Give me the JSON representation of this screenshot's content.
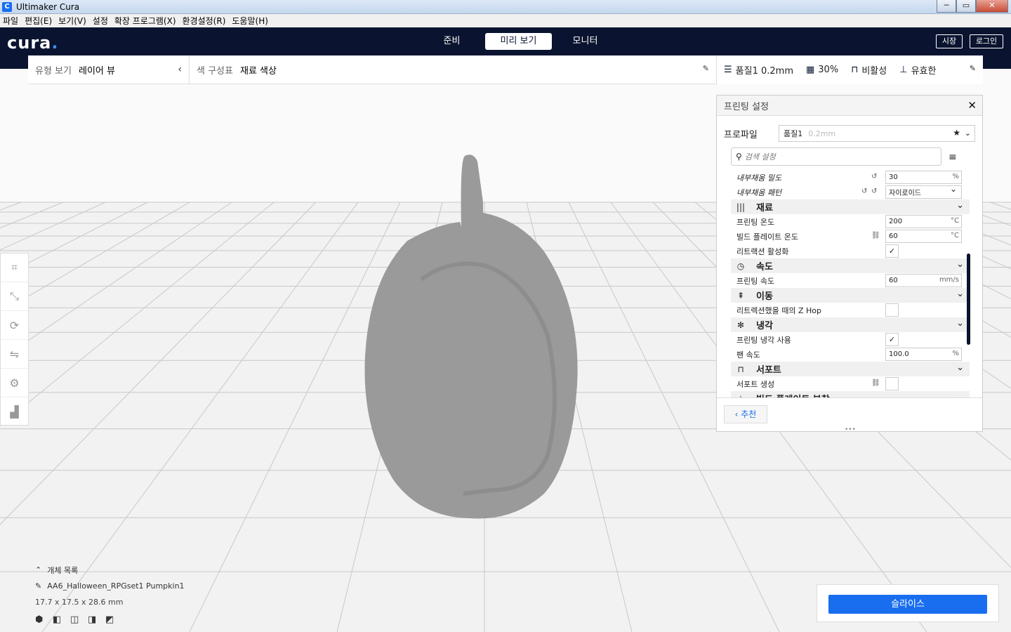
{
  "window": {
    "title": "Ultimaker Cura",
    "app_icon": "C",
    "minimize": "─",
    "maximize": "▭",
    "close": "✕"
  },
  "menubar": [
    "파일",
    "편집(E)",
    "보기(V)",
    "설정",
    "확장 프로그램(X)",
    "환경설정(R)",
    "도움말(H)"
  ],
  "header": {
    "logo": "cura",
    "tabs": [
      "준비",
      "미리 보기",
      "모니터"
    ],
    "active_tab": "미리 보기",
    "marketplace": "시장",
    "login": "로그인"
  },
  "viewpanel": {
    "view_type_label": "유형 보기",
    "view_type_value": "레이어 뷰",
    "color_scheme_label": "색 구성표",
    "color_scheme_value": "재료 색상"
  },
  "setupbar": {
    "profile": "품질1 0.2mm",
    "infill": "30%",
    "support": "비활성",
    "adhesion": "유효한"
  },
  "settings": {
    "title": "프린팅 설정",
    "profile_label": "프로파일",
    "profile_name": "품질1",
    "profile_sub": "0.2mm",
    "search_placeholder": "검색 설정",
    "rows": [
      {
        "kind": "row",
        "name": "내부채움 밀도",
        "value": "30",
        "unit": "%"
      },
      {
        "kind": "row",
        "name": "내부채움 패턴",
        "value": "자이로이드"
      },
      {
        "kind": "cat",
        "name": "재료"
      },
      {
        "kind": "row",
        "name": "프린팅 온도",
        "value": "200",
        "unit": "°C"
      },
      {
        "kind": "row",
        "name": "빌드 플레이트 온도",
        "value": "60",
        "unit": "°C"
      },
      {
        "kind": "row",
        "name": "리트랙션 활성화",
        "checked": true
      },
      {
        "kind": "cat",
        "name": "속도"
      },
      {
        "kind": "row",
        "name": "프린팅 속도",
        "value": "60",
        "unit": "mm/s"
      },
      {
        "kind": "cat",
        "name": "이동"
      },
      {
        "kind": "row",
        "name": "리트렉션했을 때의 Z Hop",
        "checked": false
      },
      {
        "kind": "cat",
        "name": "냉각"
      },
      {
        "kind": "row",
        "name": "프린팅 냉각 사용",
        "checked": true
      },
      {
        "kind": "row",
        "name": "팬 속도",
        "value": "100.0",
        "unit": "%"
      },
      {
        "kind": "cat",
        "name": "서포트"
      },
      {
        "kind": "row",
        "name": "서포트 생성",
        "checked": false
      },
      {
        "kind": "cat",
        "name": "빌드 플레이트 부착"
      }
    ],
    "recommended_label": "추천"
  },
  "objects": {
    "header": "개체 목록",
    "name": "AA6_Halloween_RPGset1 Pumpkin1",
    "dimensions": "17.7 x 17.5 x 28.6 mm"
  },
  "slice_label": "슬라이스",
  "colors": {
    "header_bg": "#0a1430",
    "accent": "#196ef0",
    "model": "#9a9a9a"
  }
}
